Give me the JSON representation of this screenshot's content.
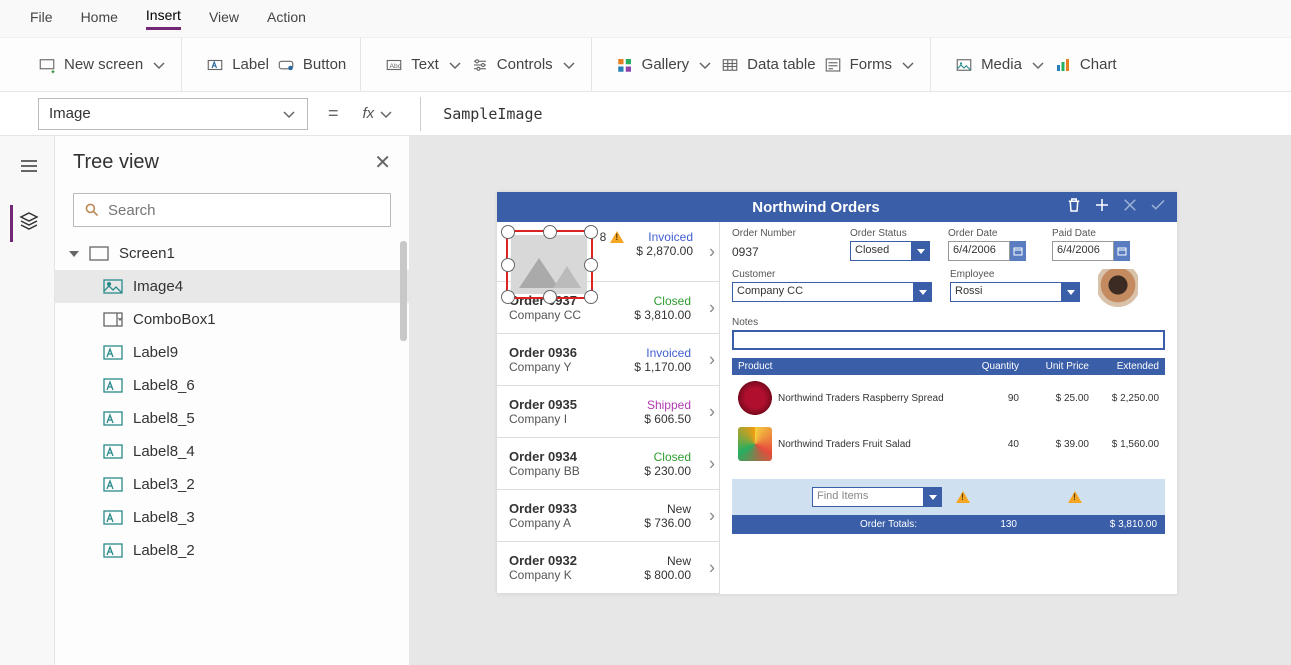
{
  "top_tabs": {
    "file": "File",
    "home": "Home",
    "insert": "Insert",
    "view": "View",
    "action": "Action"
  },
  "ribbon": {
    "new_screen": "New screen",
    "label": "Label",
    "button": "Button",
    "text": "Text",
    "controls": "Controls",
    "gallery": "Gallery",
    "data_table": "Data table",
    "forms": "Forms",
    "media": "Media",
    "chart": "Chart"
  },
  "formula": {
    "property": "Image",
    "value": "SampleImage"
  },
  "tree": {
    "title": "Tree view",
    "search_placeholder": "Search",
    "root": "Screen1",
    "items": [
      "Image4",
      "ComboBox1",
      "Label9",
      "Label8_6",
      "Label8_5",
      "Label8_4",
      "Label3_2",
      "Label8_3",
      "Label8_2"
    ]
  },
  "app": {
    "title": "Northwind Orders",
    "pad8": "8",
    "orders": [
      {
        "title": "Order 0937",
        "sub": "Company CC",
        "status": "Closed",
        "status_class": "status-closed",
        "amount": "$ 3,810.00"
      },
      {
        "title": "Order 0936",
        "sub": "Company Y",
        "status": "Invoiced",
        "status_class": "status-invoiced",
        "amount": "$ 1,170.00"
      },
      {
        "title": "Order 0935",
        "sub": "Company I",
        "status": "Shipped",
        "status_class": "status-shipped",
        "amount": "$ 606.50"
      },
      {
        "title": "Order 0934",
        "sub": "Company BB",
        "status": "Closed",
        "status_class": "status-closed",
        "amount": "$ 230.00"
      },
      {
        "title": "Order 0933",
        "sub": "Company A",
        "status": "New",
        "status_class": "status-new",
        "amount": "$ 736.00"
      },
      {
        "title": "Order 0932",
        "sub": "Company K",
        "status": "New",
        "status_class": "status-new",
        "amount": "$ 800.00"
      }
    ],
    "first_hidden": {
      "status": "Invoiced",
      "amount": "$ 2,870.00"
    },
    "detail": {
      "labels": {
        "order_number": "Order Number",
        "order_status": "Order Status",
        "order_date": "Order Date",
        "paid_date": "Paid Date",
        "customer": "Customer",
        "employee": "Employee",
        "notes": "Notes"
      },
      "order_number": "0937",
      "order_status": "Closed",
      "order_date": "6/4/2006",
      "paid_date": "6/4/2006",
      "customer": "Company CC",
      "employee": "Rossi"
    },
    "prod_head": {
      "product": "Product",
      "qty": "Quantity",
      "price": "Unit Price",
      "ext": "Extended"
    },
    "products": [
      {
        "name": "Northwind Traders Raspberry Spread",
        "qty": "90",
        "price": "$ 25.00",
        "ext": "$ 2,250.00",
        "thumb": "raspberry"
      },
      {
        "name": "Northwind Traders Fruit Salad",
        "qty": "40",
        "price": "$ 39.00",
        "ext": "$ 1,560.00",
        "thumb": "fruit"
      }
    ],
    "find_placeholder": "Find Items",
    "totals": {
      "label": "Order Totals:",
      "qty": "130",
      "ext": "$ 3,810.00"
    }
  }
}
